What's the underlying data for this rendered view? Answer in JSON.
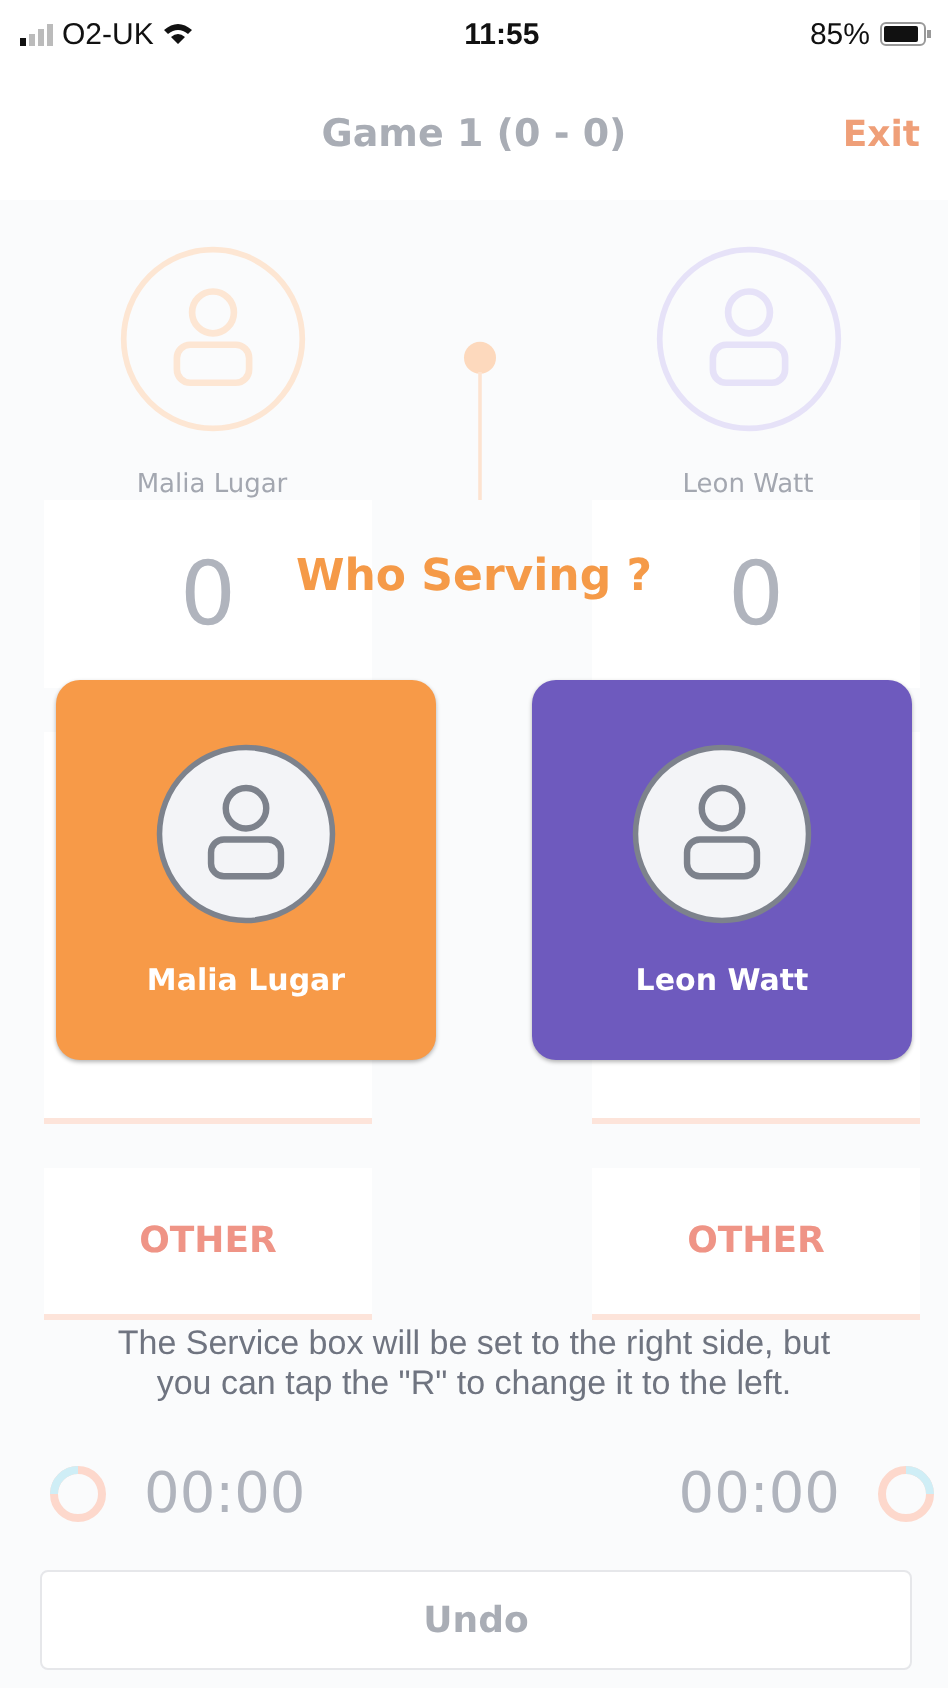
{
  "status_bar": {
    "carrier": "O2-UK",
    "time": "11:55",
    "battery": "85%"
  },
  "header": {
    "title": "Game 1 (0 - 0)",
    "exit": "Exit"
  },
  "players": [
    {
      "name": "Malia Lugar",
      "score": "0",
      "other": "OTHER",
      "timer": "00:00"
    },
    {
      "name": "Leon Watt",
      "score": "0",
      "other": "OTHER",
      "timer": "00:00"
    }
  ],
  "undo": "Undo",
  "dialog": {
    "title": "Who Serving ?",
    "options": [
      {
        "name": "Malia Lugar",
        "color": "#f79a48"
      },
      {
        "name": "Leon Watt",
        "color": "#6e5abe"
      }
    ],
    "message": "The Service box will be set to the right side, but you can tap the \"R\" to change it to the left."
  }
}
